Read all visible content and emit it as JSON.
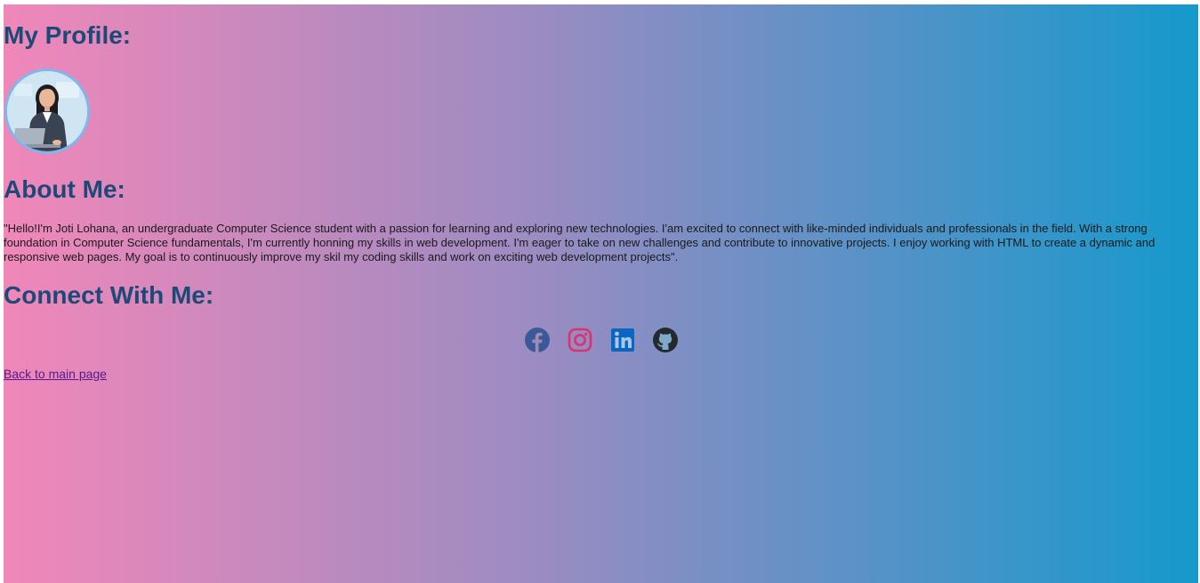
{
  "profile": {
    "heading": "My Profile:",
    "avatar_icon": "woman-with-laptop-avatar"
  },
  "about": {
    "heading": "About Me:",
    "text": "\"Hello!I'm Joti Lohana, an undergraduate Computer Science student with a passion for learning and exploring new technologies. I'am excited to connect with like-minded individuals and professionals in the field. With a strong foundation in Computer Science fundamentals, I'm currently honning my skills in web development. I'm eager to take on new challenges and contribute to innovative projects. I enjoy working with HTML to create a dynamic and responsive web pages. My goal is to continuously improve my skil my coding skills and work on exciting web development projects\"."
  },
  "connect": {
    "heading": "Connect With Me:",
    "links": [
      {
        "icon": "facebook-icon",
        "color": "#3b5998"
      },
      {
        "icon": "instagram-icon",
        "color": "#e1306c"
      },
      {
        "icon": "linkedin-icon",
        "color": "#0a66c2"
      },
      {
        "icon": "github-icon",
        "color": "#24292e"
      }
    ]
  },
  "back_link": "Back to main page",
  "colors": {
    "gradient_start": "#f187b9",
    "gradient_end": "#1599cc",
    "heading": "#1c4a78"
  }
}
